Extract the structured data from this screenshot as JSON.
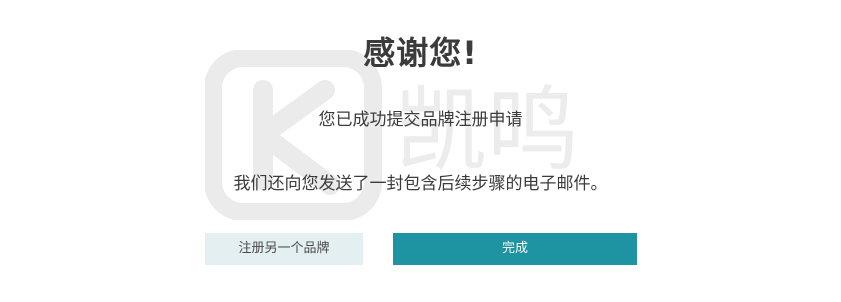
{
  "dialog": {
    "title": "感谢您!",
    "subtitle": "您已成功提交品牌注册申请",
    "message": "我们还向您发送了一封包含后续步骤的电子邮件。"
  },
  "buttons": {
    "register_another_label": "注册另一个品牌",
    "done_label": "完成"
  },
  "watermark": {
    "text": "凯鸣"
  },
  "colors": {
    "primary": "#1e94a3",
    "secondary_bg": "#e4eff2",
    "text": "#3b3b3b",
    "watermark": "#e9e9e9"
  }
}
